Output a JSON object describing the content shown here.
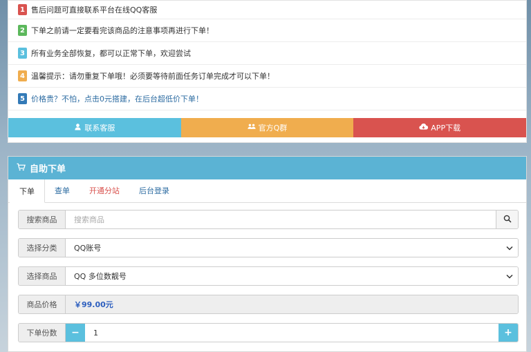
{
  "notices": [
    {
      "num": "1",
      "text": "售后问题可直接联系平台在线QQ客服",
      "color": "#d9534f",
      "blue": false
    },
    {
      "num": "2",
      "text": "下单之前请一定要看完该商品的注意事项再进行下单！",
      "color": "#5cb85c",
      "blue": false
    },
    {
      "num": "3",
      "text": "所有业务全部恢复，都可以正常下单，欢迎尝试",
      "color": "#5bc0de",
      "blue": false
    },
    {
      "num": "4",
      "text": "温馨提示：请勿重复下单哦！必须要等待前面任务订单完成才可以下单！",
      "color": "#f0ad4e",
      "blue": false
    },
    {
      "num": "5",
      "text": "价格贵？不怕，点击0元搭建，在后台超低价下单！",
      "color": "#337ab7",
      "blue": true
    }
  ],
  "buttons": {
    "contact": {
      "label": "联系客服",
      "icon": "user-icon",
      "color": "#5bc0de"
    },
    "qq_group": {
      "label": "官方Q群",
      "icon": "group-icon",
      "color": "#f0ad4e"
    },
    "app": {
      "label": "APP下载",
      "icon": "cloud-download-icon",
      "color": "#d9534f"
    }
  },
  "order_panel": {
    "title": "自助下单",
    "icon": "cart-icon",
    "tabs": [
      "下单",
      "查单",
      "开通分站",
      "后台登录"
    ],
    "search": {
      "label": "搜索商品",
      "placeholder": "搜索商品"
    },
    "category": {
      "label": "选择分类",
      "value": "QQ账号"
    },
    "product": {
      "label": "选择商品",
      "value": "QQ 多位数靓号"
    },
    "price": {
      "label": "商品价格",
      "value": "￥99.00元"
    },
    "quantity": {
      "label": "下单份数",
      "value": "1",
      "minus": "−",
      "plus": "+"
    }
  }
}
